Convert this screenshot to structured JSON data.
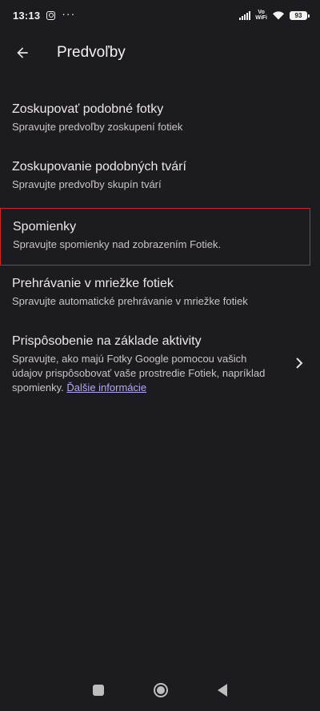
{
  "status_bar": {
    "time": "13:13",
    "more": "···",
    "volte_line1": "Vo",
    "volte_line2": "WiFi",
    "battery": "93"
  },
  "app_bar": {
    "title": "Predvoľby"
  },
  "items": [
    {
      "title": "Zoskupovať podobné fotky",
      "subtitle": "Spravujte predvoľby zoskupení fotiek"
    },
    {
      "title": "Zoskupovanie podobných tvárí",
      "subtitle": "Spravujte predvoľby skupín tvárí"
    },
    {
      "title": "Spomienky",
      "subtitle": "Spravujte spomienky nad zobrazením Fotiek."
    },
    {
      "title": "Prehrávanie v mriežke fotiek",
      "subtitle": "Spravujte automatické prehrávanie v mriežke fotiek"
    },
    {
      "title": "Prispôsobenie na základe aktivity",
      "subtitle": "Spravujte, ako majú Fotky Google pomocou vašich údajov prispôsobovať vaše prostredie Fotiek, napríklad spomienky.",
      "link": "Ďalšie informácie"
    }
  ],
  "colors": {
    "background": "#1c1b1f",
    "highlight_border": "#c62828",
    "link": "#b8a9f5"
  }
}
